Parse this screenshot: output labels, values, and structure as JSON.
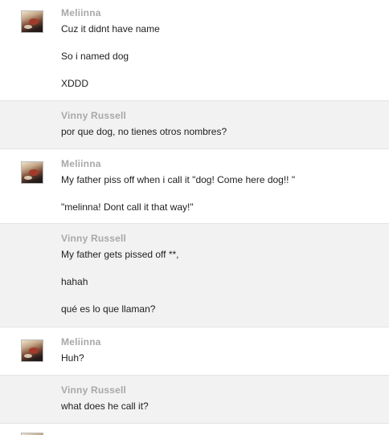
{
  "messages": [
    {
      "sender": "Meliinna",
      "has_avatar": true,
      "lines": [
        "Cuz it didnt have name",
        "So i named dog",
        "XDDD"
      ]
    },
    {
      "sender": "Vinny Russell",
      "has_avatar": false,
      "lines": [
        "por que dog, no tienes otros nombres?"
      ]
    },
    {
      "sender": "Meliinna",
      "has_avatar": true,
      "lines": [
        "My father piss off when i call it \"dog! Come here dog!! \"",
        "\"melinna! Dont call it that way!\""
      ]
    },
    {
      "sender": "Vinny Russell",
      "has_avatar": false,
      "lines": [
        "My father gets pissed off **,",
        "hahah",
        "qué es lo que llaman?"
      ]
    },
    {
      "sender": "Meliinna",
      "has_avatar": true,
      "lines": [
        "Huh?"
      ]
    },
    {
      "sender": "Vinny Russell",
      "has_avatar": false,
      "lines": [
        "what does he call it?"
      ]
    }
  ]
}
